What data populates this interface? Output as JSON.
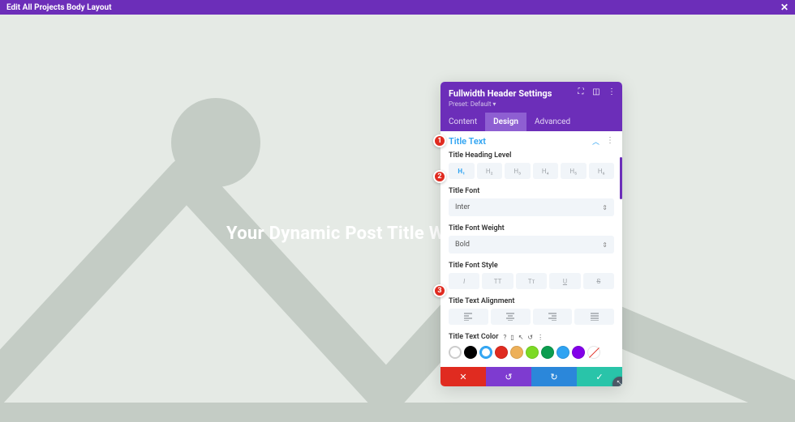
{
  "top_bar": {
    "title": "Edit All Projects Body Layout"
  },
  "canvas": {
    "title_text": "Your Dynamic Post Title Will Display Here"
  },
  "panel": {
    "header": {
      "title": "Fullwidth Header Settings",
      "preset": "Preset: Default ▾"
    },
    "tabs": {
      "content": "Content",
      "design": "Design",
      "advanced": "Advanced"
    },
    "section_title": "Title Text",
    "heading_level_label": "Title Heading Level",
    "heading_levels": [
      "H₁",
      "H₂",
      "H₃",
      "H₄",
      "H₅",
      "H₆"
    ],
    "font_label": "Title Font",
    "font_value": "Inter",
    "weight_label": "Title Font Weight",
    "weight_value": "Bold",
    "style_label": "Title Font Style",
    "style_options": [
      "I",
      "TT",
      "Tᴛ",
      "U",
      "S"
    ],
    "align_label": "Title Text Alignment",
    "color_label": "Title Text Color",
    "colors": {
      "black": "#000000",
      "white": "#ffffff",
      "red": "#e02b20",
      "yellow": "#edb059",
      "lime": "#7cda24",
      "green": "#0c9d4f",
      "blue": "#2ea3f2",
      "purple": "#8300e9"
    }
  },
  "callouts": {
    "c1": "1",
    "c2": "2",
    "c3": "3"
  }
}
